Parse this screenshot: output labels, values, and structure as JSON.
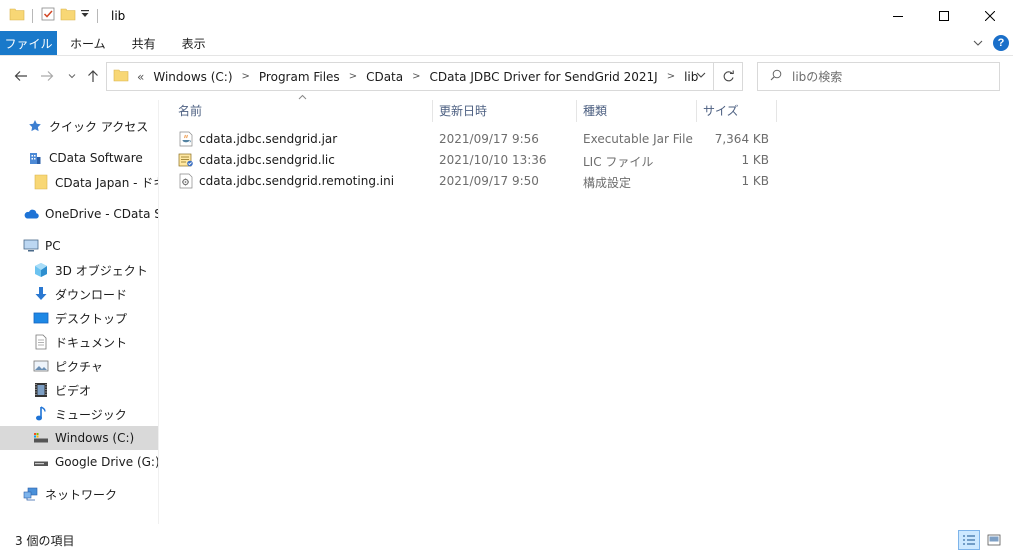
{
  "window": {
    "title": "lib"
  },
  "ribbon": {
    "tabs": [
      "ファイル",
      "ホーム",
      "共有",
      "表示"
    ]
  },
  "address": {
    "overflow": "«",
    "crumbs": [
      "Windows (C:)",
      "Program Files",
      "CData",
      "CData JDBC Driver for SendGrid 2021J",
      "lib"
    ]
  },
  "search": {
    "placeholder": "libの検索"
  },
  "sidebar": {
    "items": [
      {
        "label": "クイック アクセス",
        "icon": "star-icon"
      },
      {
        "label": "CData Software",
        "icon": "building-icon"
      },
      {
        "label": "CData Japan - ドキュメ",
        "icon": "folder-icon"
      },
      {
        "label": "OneDrive - CData Sof",
        "icon": "cloud-icon"
      },
      {
        "label": "PC",
        "icon": "pc-icon"
      },
      {
        "label": "3D オブジェクト",
        "icon": "cube-icon"
      },
      {
        "label": "ダウンロード",
        "icon": "download-icon"
      },
      {
        "label": "デスクトップ",
        "icon": "desktop-icon"
      },
      {
        "label": "ドキュメント",
        "icon": "document-icon"
      },
      {
        "label": "ピクチャ",
        "icon": "picture-icon"
      },
      {
        "label": "ビデオ",
        "icon": "video-icon"
      },
      {
        "label": "ミュージック",
        "icon": "music-icon"
      },
      {
        "label": "Windows (C:)",
        "icon": "drive-icon"
      },
      {
        "label": "Google Drive (G:)",
        "icon": "drive-icon"
      },
      {
        "label": "ネットワーク",
        "icon": "network-icon"
      }
    ]
  },
  "columns": {
    "name": "名前",
    "date": "更新日時",
    "type": "種類",
    "size": "サイズ"
  },
  "files": [
    {
      "name": "cdata.jdbc.sendgrid.jar",
      "date": "2021/09/17 9:56",
      "type": "Executable Jar File",
      "size": "7,364 KB",
      "icon": "jar-file-icon"
    },
    {
      "name": "cdata.jdbc.sendgrid.lic",
      "date": "2021/10/10 13:36",
      "type": "LIC ファイル",
      "size": "1 KB",
      "icon": "lic-file-icon"
    },
    {
      "name": "cdata.jdbc.sendgrid.remoting.ini",
      "date": "2021/09/17 9:50",
      "type": "構成設定",
      "size": "1 KB",
      "icon": "ini-file-icon"
    }
  ],
  "status": {
    "item_count": "3 個の項目"
  },
  "colors": {
    "file_tab": "#1979ca",
    "selected": "#d9d9d9",
    "folder": "#f8d775"
  }
}
